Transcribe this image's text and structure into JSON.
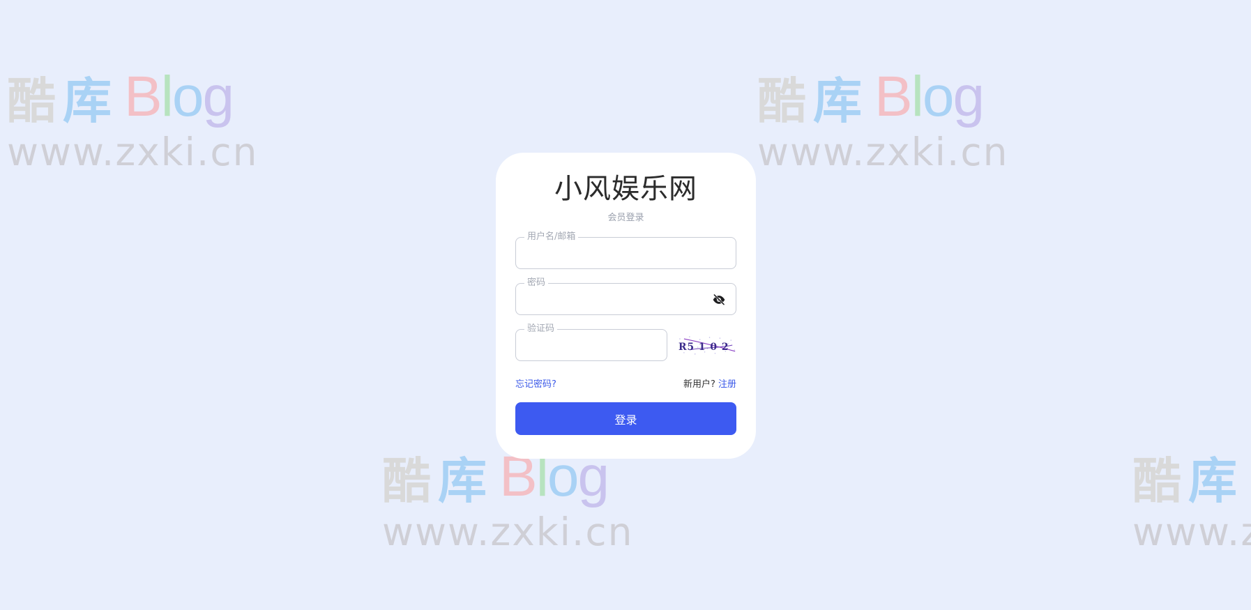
{
  "watermark": {
    "char1": "酷",
    "char2": "库",
    "blog_b": "B",
    "blog_l": "l",
    "blog_o": "o",
    "blog_g": "g",
    "url": "www.zxki.cn"
  },
  "login": {
    "title": "小风娱乐网",
    "subtitle": "会员登录",
    "username": {
      "label": "用户名/邮箱",
      "value": ""
    },
    "password": {
      "label": "密码",
      "value": ""
    },
    "captcha": {
      "label": "验证码",
      "value": "",
      "image_text": "R5 1 0 2"
    },
    "forgot_link": "忘记密码?",
    "new_user_text": "新用户?",
    "register_link": "注册",
    "submit_label": "登录"
  },
  "colors": {
    "background": "#e8eefc",
    "primary": "#3d5af1",
    "link": "#3a58e8"
  },
  "icons": {
    "password_toggle": "eye-off-icon"
  }
}
